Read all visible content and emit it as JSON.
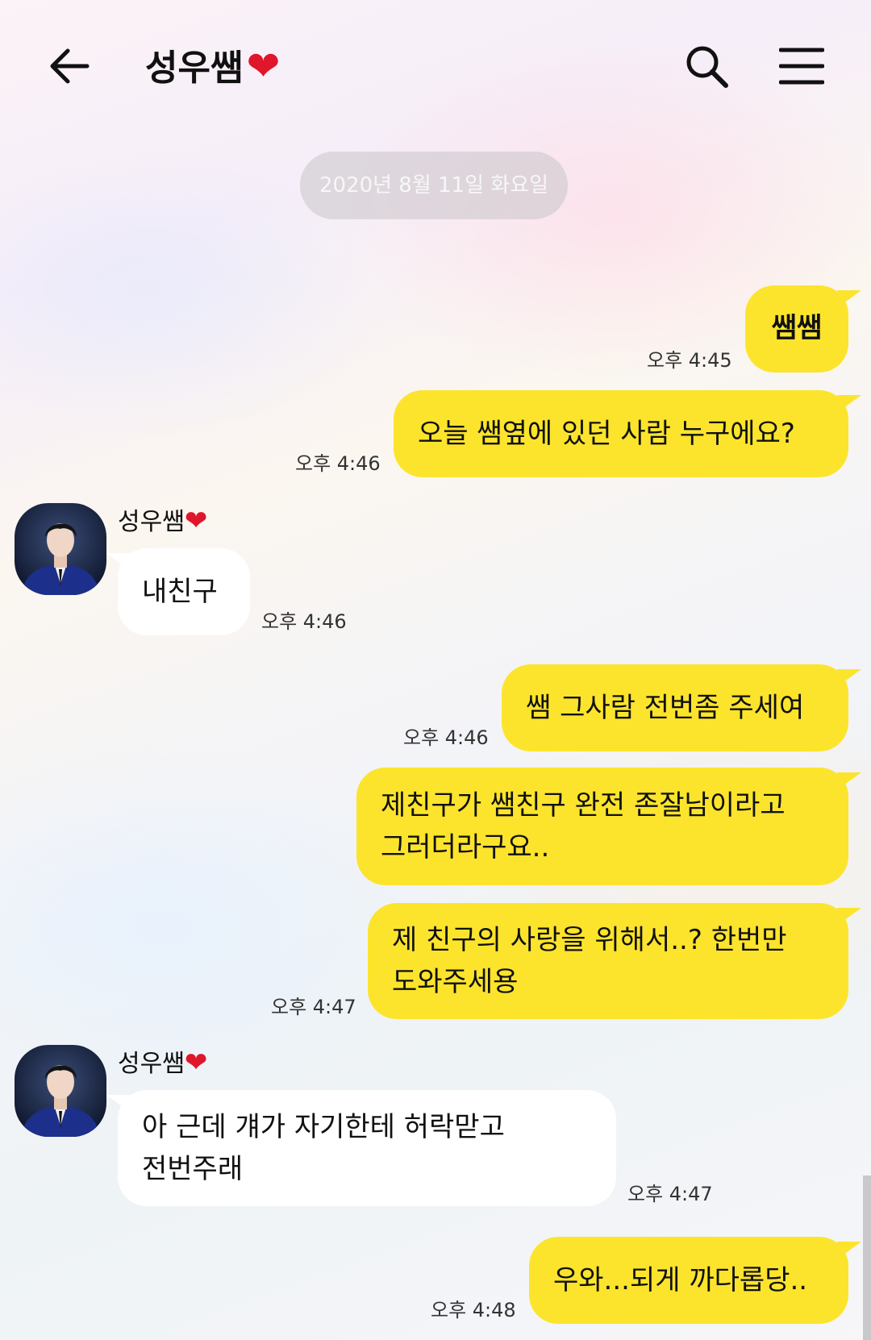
{
  "header": {
    "back_icon": "arrow-left-icon",
    "title": "성우쌤",
    "title_emoji": "❤",
    "search_icon": "search-icon",
    "menu_icon": "hamburger-menu-icon"
  },
  "date_divider": "2020년 8월 11일 화요일",
  "contact": {
    "name": "성우쌤",
    "name_emoji": "❤"
  },
  "messages": [
    {
      "from": "me",
      "text": "쌤쌤",
      "time": "오후 4:45"
    },
    {
      "from": "me",
      "text": "오늘 쌤옆에 있던 사람 누구에요?",
      "time": "오후 4:46"
    },
    {
      "from": "them",
      "text": "내친구",
      "time": "오후 4:46"
    },
    {
      "from": "me",
      "text": "쌤 그사람 전번좀 주세여",
      "time": "오후 4:46"
    },
    {
      "from": "me",
      "line1": "제친구가 쌤친구 완전 존잘남이라고",
      "line2": "그러더라구요.."
    },
    {
      "from": "me",
      "line1": "제 친구의 사랑을 위해서..? 한번만",
      "line2": "도와주세용",
      "time": "오후 4:47"
    },
    {
      "from": "them",
      "line1": "아 근데 걔가 자기한테 허락맏고",
      "line2": "전번주래",
      "time": "오후 4:47"
    },
    {
      "from": "me",
      "text": "우와...되게 까다롭당..",
      "time": "오후 4:48"
    }
  ],
  "colors": {
    "my_bubble": "#fce42c",
    "their_bubble": "#ffffff",
    "heart": "#e0162b"
  }
}
